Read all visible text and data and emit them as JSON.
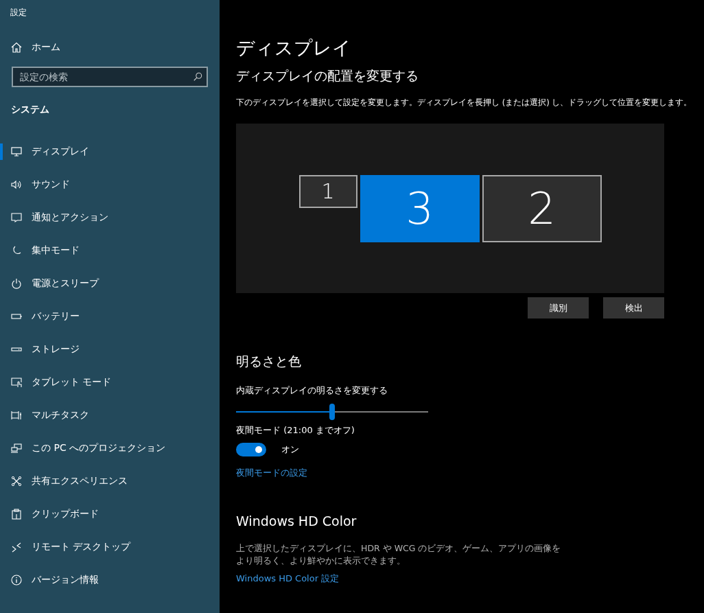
{
  "window": {
    "title": "設定"
  },
  "sidebar": {
    "home": {
      "label": "ホーム"
    },
    "search": {
      "placeholder": "設定の検索"
    },
    "section": "システム",
    "items": [
      {
        "label": "ディスプレイ",
        "selected": true
      },
      {
        "label": "サウンド",
        "selected": false
      },
      {
        "label": "通知とアクション",
        "selected": false
      },
      {
        "label": "集中モード",
        "selected": false
      },
      {
        "label": "電源とスリープ",
        "selected": false
      },
      {
        "label": "バッテリー",
        "selected": false
      },
      {
        "label": "ストレージ",
        "selected": false
      },
      {
        "label": "タブレット モード",
        "selected": false
      },
      {
        "label": "マルチタスク",
        "selected": false
      },
      {
        "label": "この PC へのプロジェクション",
        "selected": false
      },
      {
        "label": "共有エクスペリエンス",
        "selected": false
      },
      {
        "label": "クリップボード",
        "selected": false
      },
      {
        "label": "リモート デスクトップ",
        "selected": false
      },
      {
        "label": "バージョン情報",
        "selected": false
      }
    ]
  },
  "page": {
    "title": "ディスプレイ",
    "arrangement": {
      "heading": "ディスプレイの配置を変更する",
      "description": "下のディスプレイを選択して設定を変更します。ディスプレイを長押し (または選択) し、ドラッグして位置を変更します。",
      "monitors": [
        {
          "label": "1",
          "kind": "small",
          "selected": false
        },
        {
          "label": "3",
          "kind": "large",
          "selected": true
        },
        {
          "label": "2",
          "kind": "large",
          "selected": false
        }
      ],
      "buttons": [
        "識別",
        "検出"
      ]
    },
    "brightness": {
      "heading": "明るさと色",
      "slider_label": "内蔵ディスプレイの明るさを変更する",
      "level": 0.5,
      "night_label": "夜間モード (21:00 までオフ)",
      "night_on": true,
      "night_state": "オン",
      "link": "夜間モードの設定"
    },
    "hdr": {
      "heading": "Windows HD Color",
      "description": "上で選択したディスプレイに、HDR や WCG のビデオ、ゲーム、アプリの画像をより明るく、より鮮やかに表示できます。",
      "link": "Windows HD Color 設定"
    }
  }
}
